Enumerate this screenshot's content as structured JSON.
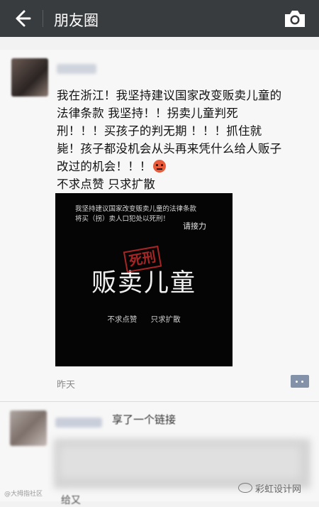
{
  "header": {
    "title": "朋友圈"
  },
  "post": {
    "text_lines": [
      "我在浙江！我坚持建议国家改变贩卖儿童的",
      "法律条款 我坚持！！拐卖儿童判死",
      "刑！！！买孩子的判无期 ！！！抓住就",
      "毙！孩子都没机会从头再来凭什么给人贩子",
      "改过的机会！！！",
      "不求点赞 只求扩散"
    ],
    "emoji": "angry-face-icon",
    "poster": {
      "line1": "我坚持建议国家改变贩卖儿童的法律条款",
      "line2": "将买（拐）卖人口犯处以死刑！",
      "relay": "请接力",
      "stamp": "死刑",
      "big": "贩卖儿童",
      "small": "不求点赞  只求扩散"
    },
    "time": "昨天"
  },
  "post2": {
    "shared_text": "享了一个链接",
    "tail_text": "给又"
  },
  "watermark": {
    "left": "@大拇指社区",
    "right": "彩虹设计网"
  },
  "colors": {
    "topbar": "#383c3f",
    "background": "#f7f7f7",
    "comment_button": "#8391a9",
    "stamp_red": "#c62b2b"
  }
}
